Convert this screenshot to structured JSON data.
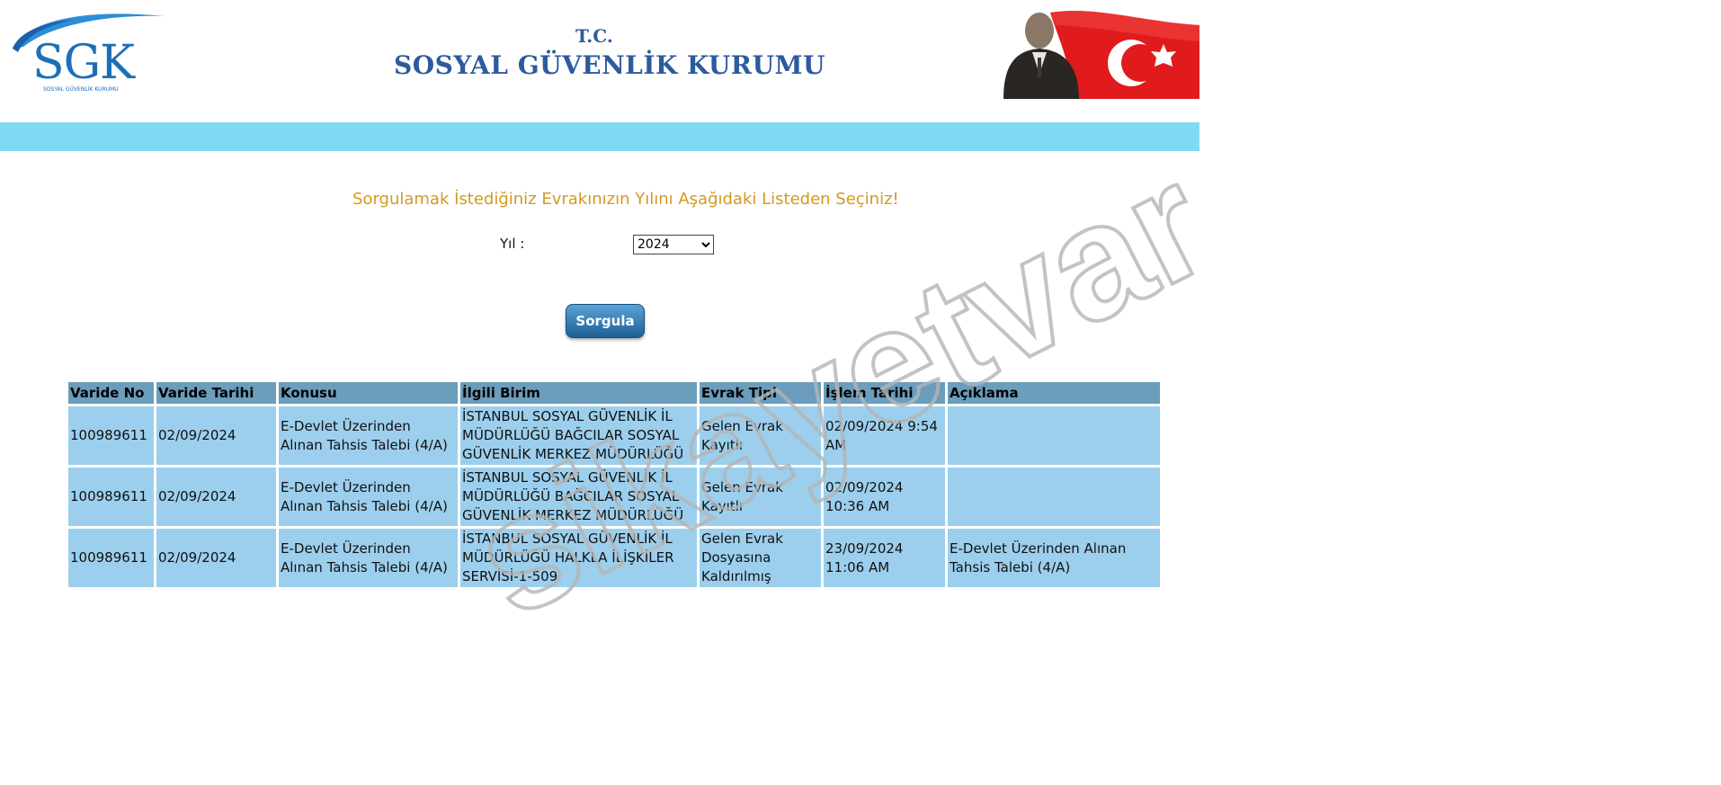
{
  "header": {
    "logo_text": "SGK",
    "logo_subtitle": "SOSYAL GÜVENLİK KURUMU",
    "tc": "T.C.",
    "institution": "SOSYAL GÜVENLİK KURUMU"
  },
  "form": {
    "instruction": "Sorgulamak İstediğiniz Evrakınızın Yılını Aşağıdaki Listeden Seçiniz!",
    "year_label": "Yıl :",
    "year_selected": "2024",
    "submit_label": "Sorgula"
  },
  "table": {
    "headers": [
      "Varide No",
      "Varide Tarihi",
      "Konusu",
      "İlgili Birim",
      "Evrak Tipi",
      "İşlem Tarihi",
      "Açıklama"
    ],
    "rows": [
      [
        "100989611",
        "02/09/2024",
        "E-Devlet Üzerinden Alınan Tahsis Talebi (4/A)",
        "İSTANBUL SOSYAL GÜVENLİK İL MÜDÜRLÜĞÜ BAĞCILAR SOSYAL GÜVENLİK MERKEZ MÜDÜRLÜĞÜ",
        "Gelen Evrak Kayıtlı",
        "02/09/2024 9:54 AM",
        ""
      ],
      [
        "100989611",
        "02/09/2024",
        "E-Devlet Üzerinden Alınan Tahsis Talebi (4/A)",
        "İSTANBUL SOSYAL GÜVENLİK İL MÜDÜRLÜĞÜ BAĞCILAR SOSYAL GÜVENLİK MERKEZ MÜDÜRLÜĞÜ",
        "Gelen Evrak Kayıtlı",
        "02/09/2024 10:36 AM",
        ""
      ],
      [
        "100989611",
        "02/09/2024",
        "E-Devlet Üzerinden Alınan Tahsis Talebi (4/A)",
        "İSTANBUL SOSYAL GÜVENLİK İL MÜDÜRLÜĞÜ HALKLA İLİŞKİLER SERVİSİ-1-509",
        "Gelen Evrak Dosyasına Kaldırılmış",
        "23/09/2024 11:06 AM",
        "E-Devlet Üzerinden Alınan Tahsis Talebi (4/A)"
      ]
    ]
  },
  "watermark": "sikayetvar",
  "colors": {
    "band": "#80d9f3",
    "instruction": "#d49a1e",
    "header_cell": "#6b9dbc",
    "data_cell": "#9ccfed",
    "brand_blue": "#2c5a9e"
  },
  "icons": {
    "logo": "sgk-logo-icon",
    "portrait": "ataturk-flag-image"
  }
}
